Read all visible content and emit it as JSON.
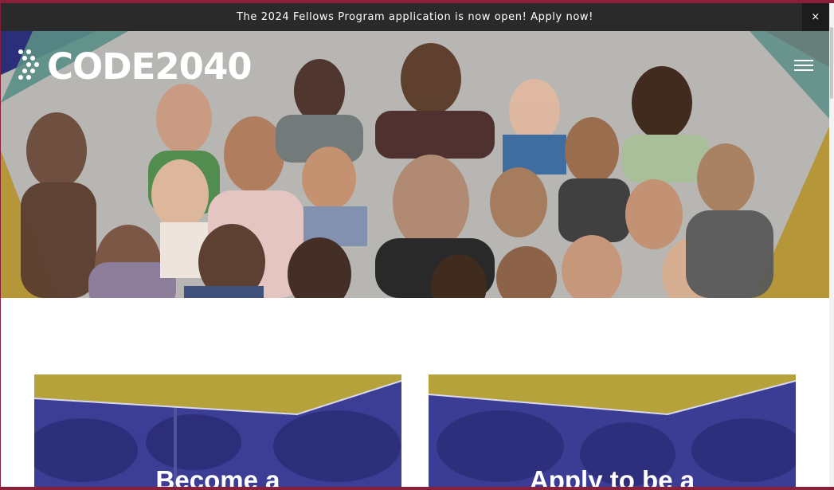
{
  "announcement": {
    "text": "The 2024 Fellows Program application is now open! Apply now!",
    "close_label": "×"
  },
  "header": {
    "logo_text": "CODE2040",
    "menu_icon": "hamburger-menu-icon"
  },
  "hero": {
    "image": "group-photo-of-people"
  },
  "cards": [
    {
      "title": "Become a"
    },
    {
      "title": "Apply to be a"
    }
  ],
  "colors": {
    "announcement_bg": "#2a2a2a",
    "hero_bg": "#b8b6b2",
    "accent_gold": "#b5973a",
    "accent_teal": "#5a8e86",
    "accent_navy": "#2b2f7a",
    "accent_red": "#b0283c",
    "card_blue": "#3a3a8f"
  }
}
